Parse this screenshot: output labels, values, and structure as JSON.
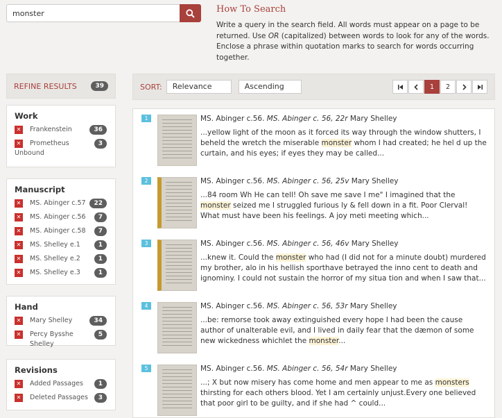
{
  "search": {
    "value": "monster",
    "button_icon": "search-icon"
  },
  "howto": {
    "title": "How To Search",
    "text_a": "Write a query in the search field. All words must appear on a page to be returned. Use ",
    "text_or": "OR",
    "text_b": " (capitalized) between words to look for any of the words. Enclose a phrase within quotation marks to search for words occurring together."
  },
  "refine": {
    "label": "REFINE RESULTS",
    "count": "39"
  },
  "facets": [
    {
      "title": "Work",
      "items": [
        {
          "label": "Frankenstein",
          "count": "36"
        },
        {
          "label": "Prometheus Unbound",
          "count": "3"
        }
      ]
    },
    {
      "title": "Manuscript",
      "items": [
        {
          "label": "MS. Abinger c.57",
          "count": "22"
        },
        {
          "label": "MS. Abinger c.56",
          "count": "7"
        },
        {
          "label": "MS. Abinger c.58",
          "count": "7"
        },
        {
          "label": "MS. Shelley e.1",
          "count": "1"
        },
        {
          "label": "MS. Shelley e.2",
          "count": "1"
        },
        {
          "label": "MS. Shelley e.3",
          "count": "1"
        }
      ]
    },
    {
      "title": "Hand",
      "items": [
        {
          "label": "Mary Shelley",
          "count": "34"
        },
        {
          "label": "Percy Bysshe Shelley",
          "count": "5"
        }
      ]
    },
    {
      "title": "Revisions",
      "items": [
        {
          "label": "Added Passages",
          "count": "1"
        },
        {
          "label": "Deleted Passages",
          "count": "3"
        }
      ]
    }
  ],
  "sort": {
    "label": "SORT:",
    "by": "Relevance",
    "order": "Ascending"
  },
  "pagination": {
    "first": "⏮",
    "prev": "‹",
    "pages": [
      "1",
      "2"
    ],
    "current": "1",
    "next": "›",
    "last": "⏭"
  },
  "results": [
    {
      "num": "1",
      "ms": "MS. Abinger c.56.",
      "ref": "MS. Abinger c. 56, 22r",
      "author": "Mary Shelley",
      "pre": "...yellow light of the moon as it forced its way through the window shutters, I beheld the wretch the miserable ",
      "hit": "monster",
      "post": " whom I had created; he hel d up the curtain, and his eyes; if eyes they may be called..."
    },
    {
      "num": "2",
      "ms": "MS. Abinger c.56.",
      "ref": "MS. Abinger c. 56, 25v",
      "author": "Mary Shelley",
      "pre": "...84 room Wh He can tell! Oh save me save I me\" I imagined that the ",
      "hit": "monster",
      "post": " seized me I struggled furious ly & fell down in a fit. Poor Clerval! What must have been his feelings. A joy meti meeting which..."
    },
    {
      "num": "3",
      "ms": "MS. Abinger c.56.",
      "ref": "MS. Abinger c. 56, 46v",
      "author": "Mary Shelley",
      "pre": "...knew it. Could the ",
      "hit": "monster",
      "post": " who had (I did not for a minute doubt) murdered my brother, alo in his hellish sporthave betrayed the inno cent to death and ignominy. I could not sustain the horror of my situa tion and when I saw that..."
    },
    {
      "num": "4",
      "ms": "MS. Abinger c.56.",
      "ref": "MS. Abinger c. 56, 53r",
      "author": "Mary Shelley",
      "pre": "...be: remorse took away extinguished every hope I had been the cause author of unalterable evil, and I lived in daily fear that the dæmon of some new wickedness whichlet the ",
      "hit": "monster",
      "post": "..."
    },
    {
      "num": "5",
      "ms": "MS. Abinger c.56.",
      "ref": "MS. Abinger c. 56, 54r",
      "author": "Mary Shelley",
      "pre": "...; X but now misery has come home and men appear to me as ",
      "hit": "monsters",
      "post": " thirsting for each others blood. Yet I am certainly unjust.Every one believed that poor girl to be guilty, and if she had ^ could..."
    }
  ]
}
